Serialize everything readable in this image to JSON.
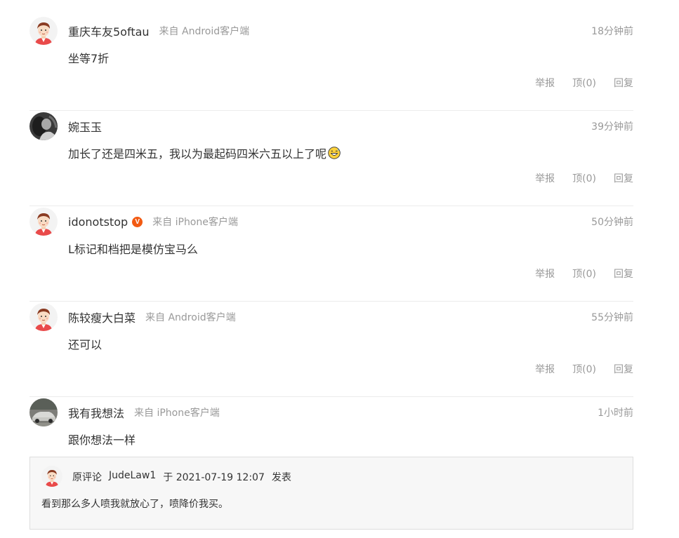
{
  "comments": [
    {
      "username": "重庆车友5oftau",
      "source": "来自 Android客户端",
      "time": "18分钟前",
      "content": "坐等7折",
      "avatar_icon": "cartoon-person-avatar",
      "verified": false,
      "report_label": "举报",
      "like_label": "顶(0)",
      "reply_label": "回复"
    },
    {
      "username": "婉玉玉",
      "source": "",
      "time": "39分钟前",
      "content": "加长了还是四米五，我以为最起码四米六五以上了呢",
      "content_emoji": "grinning-sweat-emoji",
      "avatar_icon": "photo-avatar",
      "verified": false,
      "report_label": "举报",
      "like_label": "顶(0)",
      "reply_label": "回复"
    },
    {
      "username": "idonotstop",
      "verified_mark": "V",
      "source": "来自 iPhone客户端",
      "time": "50分钟前",
      "content": "L标记和档把是模仿宝马么",
      "avatar_icon": "cartoon-person-avatar",
      "verified": true,
      "report_label": "举报",
      "like_label": "顶(0)",
      "reply_label": "回复"
    },
    {
      "username": "陈较瘦大白菜",
      "source": "来自 Android客户端",
      "time": "55分钟前",
      "content": "还可以",
      "avatar_icon": "cartoon-person-avatar",
      "verified": false,
      "report_label": "举报",
      "like_label": "顶(0)",
      "reply_label": "回复"
    },
    {
      "username": "我有我想法",
      "source": "来自 iPhone客户端",
      "time": "1小时前",
      "content": "跟你想法一样",
      "avatar_icon": "car-photo-avatar",
      "verified": false
    }
  ],
  "quote": {
    "prefix": "原评论",
    "username": "JudeLaw1",
    "at": "于 2021-07-19 12:07",
    "suffix": "发表",
    "text": "看到那么多人喷我就放心了，喷降价我买。",
    "avatar_icon": "cartoon-person-avatar"
  },
  "colors": {
    "text": "#333333",
    "meta": "#999999",
    "divider": "#ececec",
    "verified_badge": "#f25a12",
    "quote_bg": "#f7f7f7"
  }
}
